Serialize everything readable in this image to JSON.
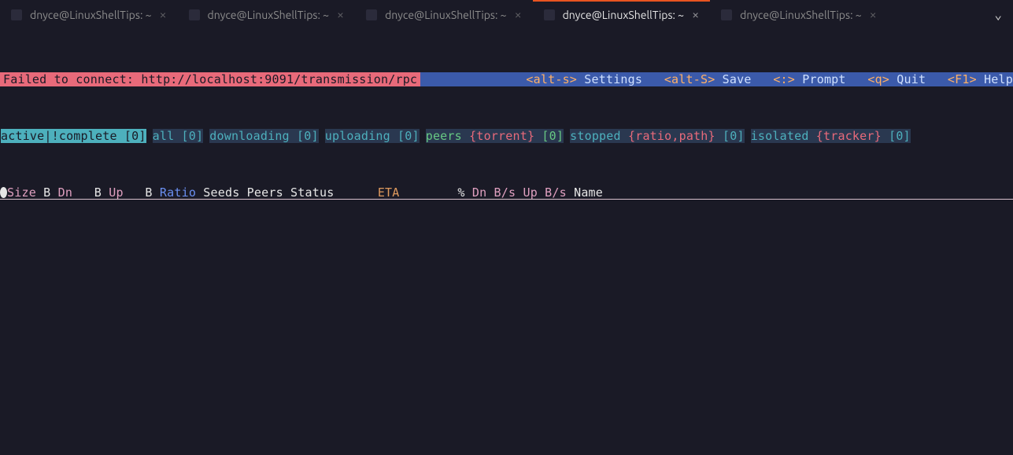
{
  "tabs": [
    {
      "title": "dnyce@LinuxShellTips: ~",
      "active": false
    },
    {
      "title": "dnyce@LinuxShellTips: ~",
      "active": false
    },
    {
      "title": "dnyce@LinuxShellTips: ~",
      "active": false
    },
    {
      "title": "dnyce@LinuxShellTips: ~",
      "active": true
    },
    {
      "title": "dnyce@LinuxShellTips: ~",
      "active": false
    }
  ],
  "error": "Failed to connect: http://localhost:9091/transmission/rpc",
  "keybinds": [
    {
      "key": "<alt-s>",
      "label": " Settings"
    },
    {
      "key": "<alt-S>",
      "label": " Save"
    },
    {
      "key": "<:>",
      "label": " Prompt"
    },
    {
      "key": "<q>",
      "label": " Quit"
    },
    {
      "key": "<F1>",
      "label": " Help"
    }
  ],
  "filters": {
    "active": "active|!complete [0]",
    "all": "all [0]",
    "downloading": "downloading [0]",
    "uploading": "uploading [0]",
    "peers": {
      "label": "peers ",
      "curly": "{torrent}",
      "count": " [0]"
    },
    "stopped": {
      "label": "stopped ",
      "curly": "{ratio,path}",
      "count": " [0]"
    },
    "isolated": {
      "label": "isolated ",
      "curly": "{tracker}",
      "count": " [0]"
    }
  },
  "columns": {
    "size": "Size",
    "b1": " B ",
    "dn": "Dn",
    "b2": "   B ",
    "up": "Up",
    "b3": "   B ",
    "ratio": "Ratio",
    "seeds": " Seeds",
    "peers": " Peers",
    "status": " Status      ",
    "eta": "ETA  ",
    "under": " _    ",
    "pct": "% ",
    "dnrate": "Dn B/s ",
    "uprate": "Up B/s ",
    "name": "Name"
  }
}
